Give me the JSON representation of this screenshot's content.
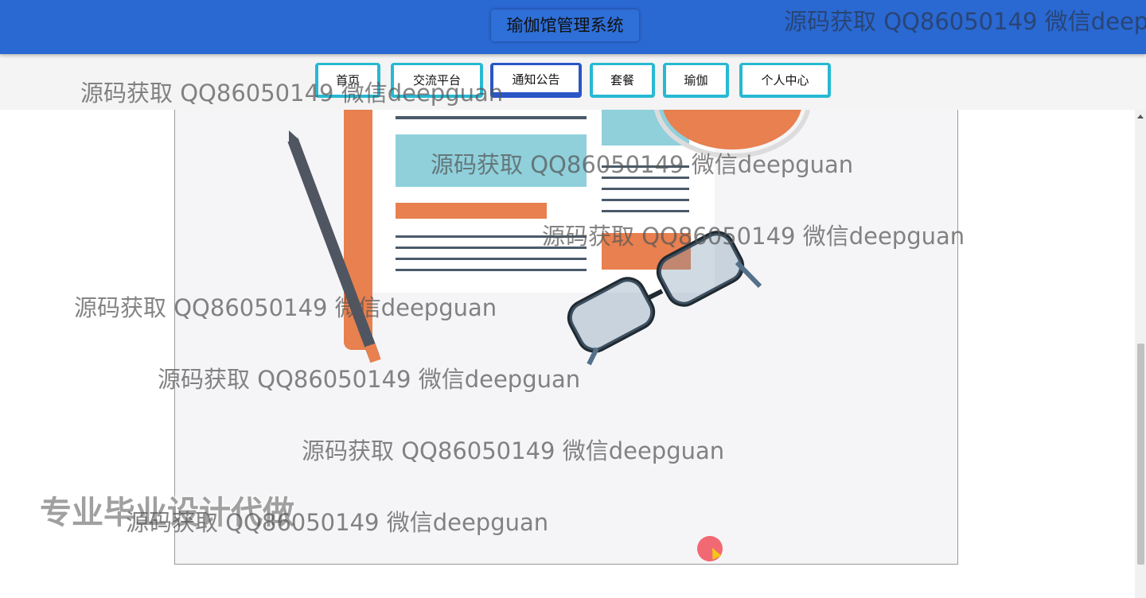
{
  "header": {
    "title": "瑜伽馆管理系统"
  },
  "nav": {
    "items": [
      {
        "label": "首页",
        "active": false
      },
      {
        "label": "交流平台",
        "active": false
      },
      {
        "label": "通知公告",
        "active": true
      },
      {
        "label": "套餐",
        "active": false
      },
      {
        "label": "瑜伽",
        "active": false
      },
      {
        "label": "个人中心",
        "active": false
      }
    ]
  },
  "watermark": {
    "text": "源码获取 QQ86050149 微信deepguan",
    "top_text": "源码获取 QQ86050149 微信deep"
  },
  "promo": {
    "text": "专业毕业设计代做"
  },
  "colors": {
    "header_bg": "#2a68d2",
    "nav_border": "#27b9d2",
    "nav_active_border": "#2a56c6",
    "illustration_orange": "#e8804f",
    "illustration_teal": "#8fd0db"
  }
}
